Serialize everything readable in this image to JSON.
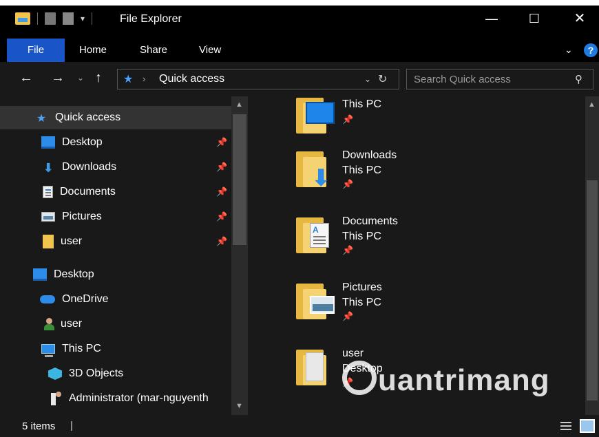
{
  "window": {
    "title": "File Explorer",
    "min_glyph": "—",
    "max_glyph": "☐",
    "close_glyph": "✕"
  },
  "ribbon": {
    "tabs": [
      {
        "label": "File"
      },
      {
        "label": "Home"
      },
      {
        "label": "Share"
      },
      {
        "label": "View"
      }
    ],
    "help": "?"
  },
  "address": {
    "path": "Quick access",
    "search_placeholder": "Search Quick access"
  },
  "sidebar": {
    "quick_access": "Quick access",
    "pinned": [
      {
        "label": "Desktop",
        "icon": "desktop-icon"
      },
      {
        "label": "Downloads",
        "icon": "downloads-icon"
      },
      {
        "label": "Documents",
        "icon": "documents-icon"
      },
      {
        "label": "Pictures",
        "icon": "pictures-icon"
      },
      {
        "label": "user",
        "icon": "folder-icon"
      }
    ],
    "tree": [
      {
        "label": "Desktop",
        "icon": "desktop-icon"
      },
      {
        "label": "OneDrive",
        "icon": "onedrive-icon"
      },
      {
        "label": "user",
        "icon": "user-icon"
      },
      {
        "label": "This PC",
        "icon": "this-pc-icon"
      },
      {
        "label": "3D Objects",
        "icon": "3d-objects-icon"
      },
      {
        "label": "Administrator (mar-nguyenth",
        "icon": "administrator-icon"
      }
    ]
  },
  "content": {
    "items": [
      {
        "name": "",
        "location": "This PC",
        "icon": "desktop-folder-icon"
      },
      {
        "name": "Downloads",
        "location": "This PC",
        "icon": "downloads-folder-icon"
      },
      {
        "name": "Documents",
        "location": "This PC",
        "icon": "documents-folder-icon"
      },
      {
        "name": "Pictures",
        "location": "This PC",
        "icon": "pictures-folder-icon"
      },
      {
        "name": "user",
        "location": "Desktop",
        "icon": "user-folder-icon"
      }
    ]
  },
  "status": {
    "count": "5 items"
  },
  "watermark": "uantrimang",
  "colors": {
    "accent": "#1a55c8",
    "background": "#191919",
    "folder": "#f1c44d"
  }
}
